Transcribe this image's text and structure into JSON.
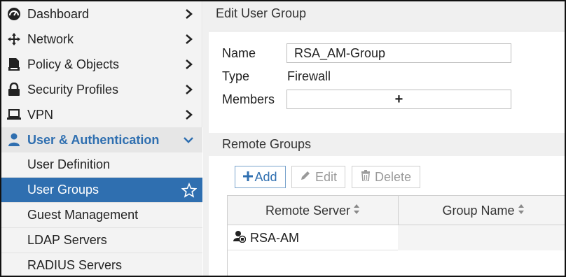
{
  "sidebar": {
    "items": [
      {
        "label": "Dashboard",
        "icon": "dashboard-icon"
      },
      {
        "label": "Network",
        "icon": "move-arrows-icon"
      },
      {
        "label": "Policy & Objects",
        "icon": "policy-icon"
      },
      {
        "label": "Security Profiles",
        "icon": "lock-icon"
      },
      {
        "label": "VPN",
        "icon": "laptop-icon"
      },
      {
        "label": "User & Authentication",
        "icon": "user-icon"
      }
    ],
    "sub_items": [
      {
        "label": "User Definition"
      },
      {
        "label": "User Groups"
      },
      {
        "label": "Guest Management"
      },
      {
        "label": "LDAP Servers"
      },
      {
        "label": "RADIUS Servers"
      }
    ],
    "active_sub_item": "User Groups"
  },
  "main": {
    "title": "Edit User Group",
    "form": {
      "name_label": "Name",
      "name_value": "RSA_AM-Group",
      "type_label": "Type",
      "type_value": "Firewall",
      "members_label": "Members",
      "members_add": "+"
    },
    "remote_groups": {
      "title": "Remote Groups",
      "toolbar": {
        "add": "Add",
        "edit": "Edit",
        "delete": "Delete"
      },
      "columns": [
        "Remote Server",
        "Group Name"
      ],
      "rows": [
        {
          "remote_server": "RSA-AM",
          "group_name": ""
        }
      ]
    }
  },
  "colors": {
    "accent": "#2f6fb0",
    "sidebar_bg": "#f3f3f3",
    "disabled_text": "#9a9a9a"
  }
}
